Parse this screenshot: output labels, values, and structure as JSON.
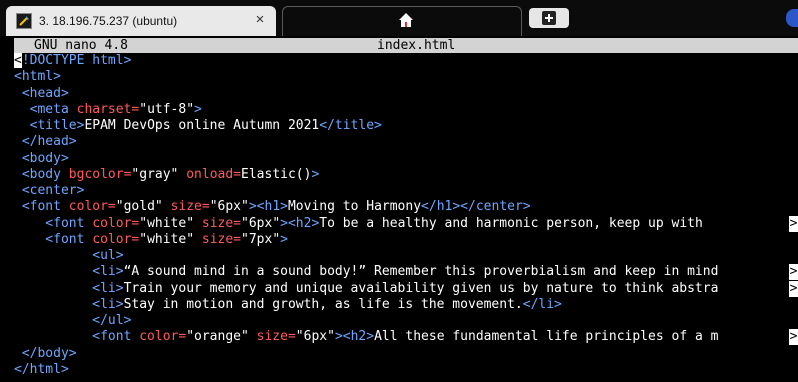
{
  "tabs": {
    "active": {
      "title": "3. 18.196.75.237 (ubuntu)",
      "close": "×",
      "icon": "terminal-icon"
    },
    "inactive": {
      "icon": "home-icon"
    },
    "new_tab": {
      "icon": "plus-icon"
    }
  },
  "nano": {
    "version": "GNU nano 4.8",
    "filename": "index.html"
  },
  "colors": {
    "tag": "#6ea6ff",
    "attr": "#ff5a5a",
    "text": "#ffffff",
    "header_bg": "#d3d3d3"
  },
  "code": {
    "overflow_marker": ">",
    "lines": [
      [
        {
          "t": "<!DOCTYPE html>",
          "c": "tag",
          "cursor_first": true
        }
      ],
      [
        {
          "t": "<html>",
          "c": "tag"
        }
      ],
      [
        {
          "t": " <head>",
          "c": "tag"
        }
      ],
      [
        {
          "t": "  <meta ",
          "c": "tag"
        },
        {
          "t": "charset=",
          "c": "attr"
        },
        {
          "t": "\"utf-8\"",
          "c": "str"
        },
        {
          "t": ">",
          "c": "tag"
        }
      ],
      [
        {
          "t": "  <title>",
          "c": "tag"
        },
        {
          "t": "EPAM DevOps online Autumn 2021",
          "c": "text"
        },
        {
          "t": "</title>",
          "c": "tag"
        }
      ],
      [
        {
          "t": " </head>",
          "c": "tag"
        }
      ],
      [
        {
          "t": " <body>",
          "c": "tag"
        }
      ],
      [
        {
          "t": " <body ",
          "c": "tag"
        },
        {
          "t": "bgcolor=",
          "c": "attr"
        },
        {
          "t": "\"gray\" ",
          "c": "str"
        },
        {
          "t": "onload=",
          "c": "attr"
        },
        {
          "t": "Elastic()",
          "c": "text"
        },
        {
          "t": ">",
          "c": "tag"
        }
      ],
      [
        {
          "t": " <center>",
          "c": "tag"
        }
      ],
      [
        {
          "t": " <font ",
          "c": "tag"
        },
        {
          "t": "color=",
          "c": "attr"
        },
        {
          "t": "\"gold\" ",
          "c": "str"
        },
        {
          "t": "size=",
          "c": "attr"
        },
        {
          "t": "\"6px\"",
          "c": "str"
        },
        {
          "t": "><h1>",
          "c": "tag"
        },
        {
          "t": "Moving to Harmony",
          "c": "text"
        },
        {
          "t": "</h1></center>",
          "c": "tag"
        }
      ],
      [
        {
          "t": "    <font ",
          "c": "tag"
        },
        {
          "t": "color=",
          "c": "attr"
        },
        {
          "t": "\"white\" ",
          "c": "str"
        },
        {
          "t": "size=",
          "c": "attr"
        },
        {
          "t": "\"6px\"",
          "c": "str"
        },
        {
          "t": "><h2>",
          "c": "tag"
        },
        {
          "t": "To be a healthy and harmonic person, keep up with",
          "c": "text"
        }
      ],
      [
        {
          "t": "    <font ",
          "c": "tag"
        },
        {
          "t": "color=",
          "c": "attr"
        },
        {
          "t": "\"white\" ",
          "c": "str"
        },
        {
          "t": "size=",
          "c": "attr"
        },
        {
          "t": "\"7px\"",
          "c": "str"
        },
        {
          "t": ">",
          "c": "tag"
        }
      ],
      [
        {
          "t": "          <ul>",
          "c": "tag"
        }
      ],
      [
        {
          "t": "          <li>",
          "c": "tag"
        },
        {
          "t": "“A sound mind in a sound body!” Remember this proverbialism and keep in mind",
          "c": "text"
        }
      ],
      [
        {
          "t": "          <li>",
          "c": "tag"
        },
        {
          "t": "Train your memory and unique availability given us by nature to think abstra",
          "c": "text"
        }
      ],
      [
        {
          "t": "          <li>",
          "c": "tag"
        },
        {
          "t": "Stay in motion and growth, as life is the movement.",
          "c": "text"
        },
        {
          "t": "</li>",
          "c": "tag"
        }
      ],
      [
        {
          "t": "          </ul>",
          "c": "tag"
        }
      ],
      [
        {
          "t": "          <font ",
          "c": "tag"
        },
        {
          "t": "color=",
          "c": "attr"
        },
        {
          "t": "\"orange\" ",
          "c": "str"
        },
        {
          "t": "size=",
          "c": "attr"
        },
        {
          "t": "\"6px\"",
          "c": "str"
        },
        {
          "t": "><h2>",
          "c": "tag"
        },
        {
          "t": "All these fundamental life principles of a m",
          "c": "text"
        }
      ],
      [
        {
          "t": " </body>",
          "c": "tag"
        }
      ],
      [
        {
          "t": "</html>",
          "c": "tag"
        }
      ]
    ],
    "truncated_lines": [
      10,
      13,
      14,
      17
    ]
  }
}
